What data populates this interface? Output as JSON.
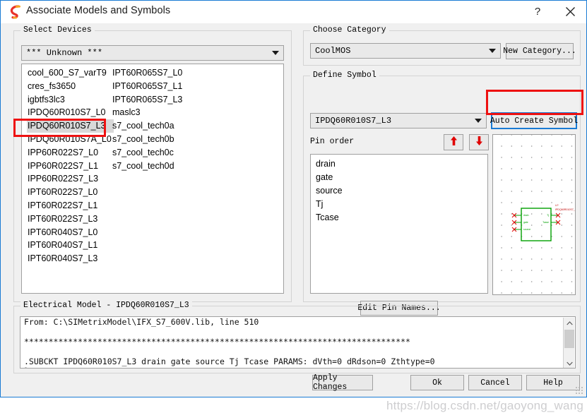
{
  "window": {
    "title": "Associate Models and Symbols",
    "logo_icon": "simetrix-s-logo-icon",
    "help_icon": "?",
    "close_icon": "close-icon",
    "border_color": "#1a7bd4"
  },
  "select_devices": {
    "group_label": "Select Devices",
    "filter_combo": {
      "value": "*** Unknown ***",
      "arrow_icon": "chevron-down-icon"
    },
    "column1": [
      "cool_600_S7_varT9",
      "cres_fs3650",
      "igbtfs3lc3",
      "IPDQ60R010S7_L0",
      "IPDQ60R010S7_L3",
      "IPDQ60R010S7A_L0",
      "IPP60R022S7_L0",
      "IPP60R022S7_L1",
      "IPP60R022S7_L3",
      "IPT60R022S7_L0",
      "IPT60R022S7_L1",
      "IPT60R022S7_L3",
      "IPT60R040S7_L0",
      "IPT60R040S7_L1",
      "IPT60R040S7_L3"
    ],
    "column2": [
      "IPT60R065S7_L0",
      "IPT60R065S7_L1",
      "IPT60R065S7_L3",
      "maslc3",
      "s7_cool_tech0a",
      "s7_cool_tech0b",
      "s7_cool_tech0c",
      "s7_cool_tech0d"
    ],
    "selected": "IPDQ60R010S7_L3",
    "selected_index": 4
  },
  "choose_category": {
    "group_label": "Choose Category",
    "category_combo": {
      "value": "CoolMOS",
      "arrow_icon": "chevron-down-icon"
    },
    "new_category_label": "New Category..."
  },
  "define_symbol": {
    "group_label": "Define Symbol",
    "symbol_combo": {
      "value": "IPDQ60R010S7_L3",
      "arrow_icon": "chevron-down-icon"
    },
    "auto_create_label": "Auto Create Symbol",
    "pin_order_label": "Pin order",
    "move_up_icon": "arrow-up-icon",
    "move_down_icon": "arrow-down-icon",
    "pins": [
      "drain",
      "gate",
      "source",
      "Tj",
      "Tcase"
    ],
    "edit_pin_names_label": "Edit Pin Names...",
    "preview": {
      "body_color": "#00a000",
      "pin_color": "#e00000",
      "ref_designator": "U?",
      "part_name": "IPDQ60R010S7_L3",
      "left_pins": [
        "drain",
        "gate",
        "source"
      ],
      "right_pins": [
        "Tj",
        "Tcase"
      ]
    }
  },
  "electrical_model": {
    "group_label": "Electrical Model - IPDQ60R010S7_L3",
    "lines": [
      "From: C:\\SIMetrixModel\\IFX_S7_600V.lib, line 510",
      "",
      "*******************************************************************************",
      "",
      ".SUBCKT IPDQ60R010S7_L3 drain gate source Tj Tcase PARAMS: dVth=0 dRdson=0 Zthtype=0"
    ],
    "line_tiny": "*",
    "line_last": "?@@--START ENCRYPTION: \"SMX_AES \"",
    "scroll_up_icon": "chevron-up-icon",
    "scroll_down_icon": "chevron-down-icon"
  },
  "footer": {
    "apply_label": "Apply Changes",
    "ok_label": "Ok",
    "cancel_label": "Cancel",
    "help_label": "Help"
  },
  "watermark": "https://blog.csdn.net/gaoyong_wang"
}
